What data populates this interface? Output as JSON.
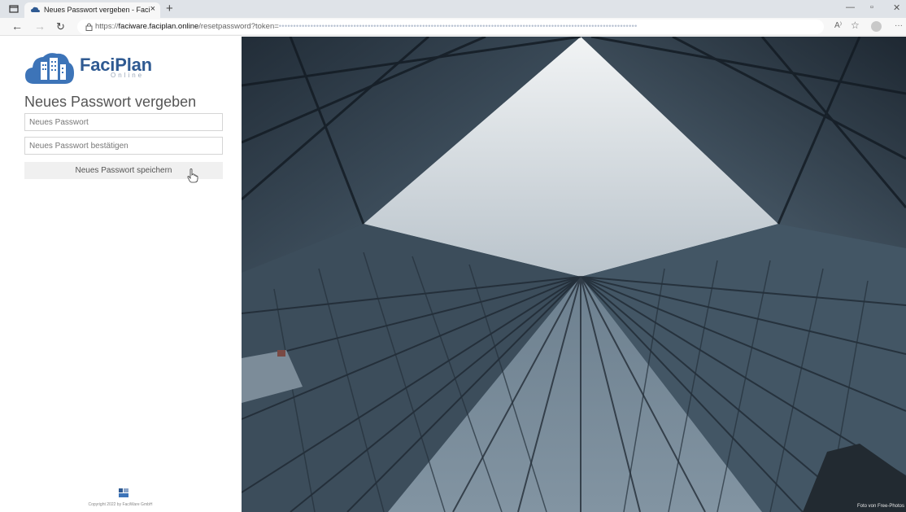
{
  "browser": {
    "tab_title": "Neues Passwort vergeben - Faci",
    "tab_close": "×",
    "new_tab": "+",
    "url_scheme": "https://",
    "url_host": "faciware.faciplan.online",
    "url_path": "/resetpassword?token=",
    "url_token": "•••••••••••••••••••••••••••••••••••••••••••••••••••••••••••••••••••••••••••••••••••••••••••••••••••••••••••••••••••••••••••••",
    "read_aloud": "A⁾",
    "favorites": "☆",
    "more": "···",
    "minimize": "—",
    "restore": "▫",
    "close": "✕"
  },
  "login": {
    "logo_name": "FaciPlan",
    "logo_sub": "Online",
    "title": "Neues Passwort vergeben",
    "new_password_placeholder": "Neues Passwort",
    "confirm_password_placeholder": "Neues Passwort bestätigen",
    "save_button": "Neues Passwort speichern",
    "copyright": "Copyright 2022 by FaciWare GmbH"
  },
  "photo": {
    "credit": "Foto von Free-Photos"
  },
  "colors": {
    "brand": "#2f5a92",
    "brand_light": "#3d74b8"
  }
}
